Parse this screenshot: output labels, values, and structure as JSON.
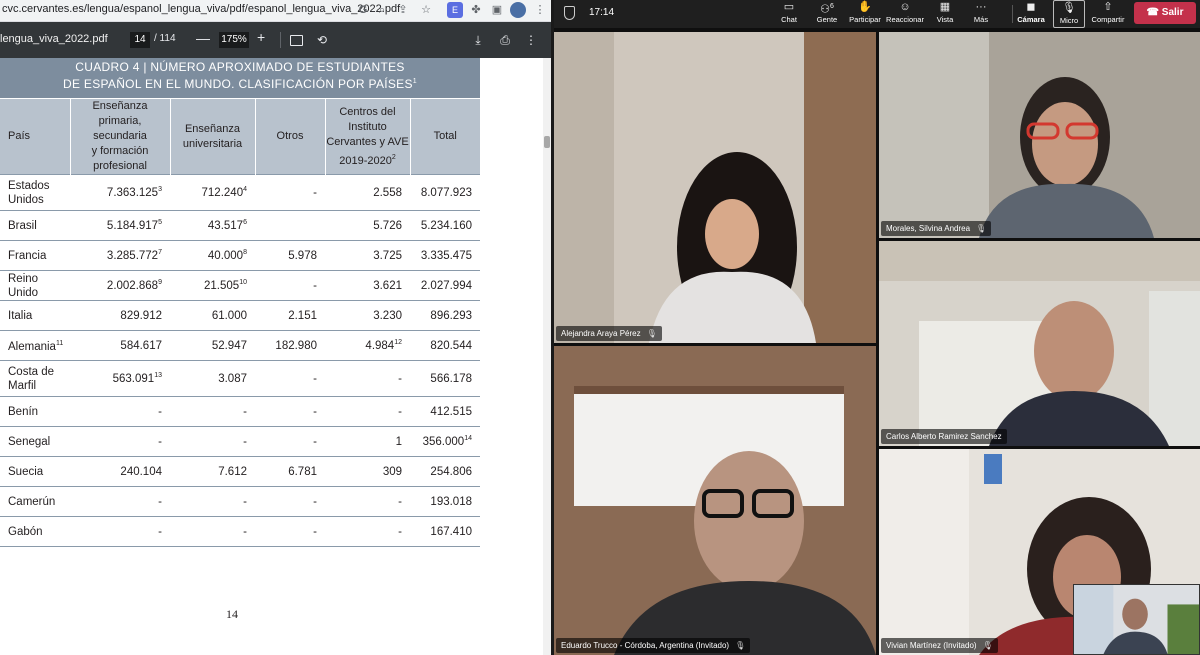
{
  "browser": {
    "url": "cvc.cervantes.es/lengua/espanol_lengua_viva/pdf/espanol_lengua_viva_2022.pdf",
    "icons": [
      "google-icon",
      "zoom-icon",
      "share-icon",
      "star-icon",
      "extension-icon",
      "puzzle-icon",
      "sidebar-icon",
      "avatar-icon"
    ]
  },
  "pdf_toolbar": {
    "filename": "lengua_viva_2022.pdf",
    "page_current": "14",
    "page_total": "/ 114",
    "zoom_minus": "—",
    "zoom": "175%",
    "zoom_plus": "+",
    "icons": [
      "fit-page-icon",
      "rotate-icon",
      "download-icon",
      "print-icon",
      "more-icon"
    ]
  },
  "document": {
    "title_line1": "CUADRO 4  |  NÚMERO APROXIMADO DE ESTUDIANTES",
    "title_line2": "DE ESPAÑOL EN EL MUNDO. CLASIFICACIÓN POR PAÍSES",
    "title_sup": "1",
    "headers": {
      "country": "País",
      "primaria": [
        "Enseñanza primaria,",
        "secundaria",
        "y formación",
        "profesional"
      ],
      "universitaria": [
        "Enseñanza",
        "universitaria"
      ],
      "otros": "Otros",
      "centros": [
        "Centros del",
        "Instituto",
        "Cervantes y AVE",
        "2019-2020"
      ],
      "centros_sup": "2",
      "total": "Total"
    },
    "rows": [
      {
        "country": [
          "Estados",
          "Unidos"
        ],
        "country_sup": "",
        "primaria": "7.363.125",
        "primaria_sup": "3",
        "universitaria": "712.240",
        "universitaria_sup": "4",
        "otros": "-",
        "centros": "2.558",
        "centros_sup": "",
        "total": "8.077.923",
        "total_sup": ""
      },
      {
        "country": [
          "Brasil"
        ],
        "country_sup": "",
        "primaria": "5.184.917",
        "primaria_sup": "5",
        "universitaria": "43.517",
        "universitaria_sup": "6",
        "otros": "",
        "centros": "5.726",
        "centros_sup": "",
        "total": "5.234.160",
        "total_sup": ""
      },
      {
        "country": [
          "Francia"
        ],
        "country_sup": "",
        "primaria": "3.285.772",
        "primaria_sup": "7",
        "universitaria": "40.000",
        "universitaria_sup": "8",
        "otros": "5.978",
        "centros": "3.725",
        "centros_sup": "",
        "total": "3.335.475",
        "total_sup": ""
      },
      {
        "country": [
          "Reino Unido"
        ],
        "country_sup": "",
        "primaria": "2.002.868",
        "primaria_sup": "9",
        "universitaria": "21.505",
        "universitaria_sup": "10",
        "otros": "-",
        "centros": "3.621",
        "centros_sup": "",
        "total": "2.027.994",
        "total_sup": ""
      },
      {
        "country": [
          "Italia"
        ],
        "country_sup": "",
        "primaria": "829.912",
        "primaria_sup": "",
        "universitaria": "61.000",
        "universitaria_sup": "",
        "otros": "2.151",
        "centros": "3.230",
        "centros_sup": "",
        "total": "896.293",
        "total_sup": ""
      },
      {
        "country": [
          "Alemania"
        ],
        "country_sup": "11",
        "primaria": "584.617",
        "primaria_sup": "",
        "universitaria": "52.947",
        "universitaria_sup": "",
        "otros": "182.980",
        "centros": "4.984",
        "centros_sup": "12",
        "total": "820.544",
        "total_sup": ""
      },
      {
        "country": [
          "Costa de",
          "Marfil"
        ],
        "country_sup": "",
        "primaria": "563.091",
        "primaria_sup": "13",
        "universitaria": "3.087",
        "universitaria_sup": "",
        "otros": "-",
        "centros": "-",
        "centros_sup": "",
        "total": "566.178",
        "total_sup": ""
      },
      {
        "country": [
          "Benín"
        ],
        "country_sup": "",
        "primaria": "-",
        "primaria_sup": "",
        "universitaria": "-",
        "universitaria_sup": "",
        "otros": "-",
        "centros": "-",
        "centros_sup": "",
        "total": "412.515",
        "total_sup": ""
      },
      {
        "country": [
          "Senegal"
        ],
        "country_sup": "",
        "primaria": "-",
        "primaria_sup": "",
        "universitaria": "-",
        "universitaria_sup": "",
        "otros": "-",
        "centros": "1",
        "centros_sup": "",
        "total": "356.000",
        "total_sup": "14"
      },
      {
        "country": [
          "Suecia"
        ],
        "country_sup": "",
        "primaria": "240.104",
        "primaria_sup": "",
        "universitaria": "7.612",
        "universitaria_sup": "",
        "otros": "6.781",
        "centros": "309",
        "centros_sup": "",
        "total": "254.806",
        "total_sup": ""
      },
      {
        "country": [
          "Camerún"
        ],
        "country_sup": "",
        "primaria": "-",
        "primaria_sup": "",
        "universitaria": "-",
        "universitaria_sup": "",
        "otros": "-",
        "centros": "-",
        "centros_sup": "",
        "total": "193.018",
        "total_sup": ""
      },
      {
        "country": [
          "Gabón"
        ],
        "country_sup": "",
        "primaria": "-",
        "primaria_sup": "",
        "universitaria": "-",
        "universitaria_sup": "",
        "otros": "-",
        "centros": "-",
        "centros_sup": "",
        "total": "167.410",
        "total_sup": ""
      }
    ],
    "page_number": "14"
  },
  "meeting": {
    "time": "17:14",
    "toolbar": {
      "chat": "Chat",
      "people": "Gente",
      "people_count": "6",
      "participate": "Participar",
      "react": "Reaccionar",
      "view": "Vista",
      "more": "Más",
      "camera": "Cámara",
      "mic": "Micro",
      "share": "Compartir",
      "leave": "Salir"
    },
    "participants": [
      {
        "name": "Alejandra Araya Pérez",
        "muted": true
      },
      {
        "name": "Morales, Silvina Andrea",
        "muted": true
      },
      {
        "name": "Carlos Alberto Ramirez Sanchez",
        "muted": false,
        "speaking": true
      },
      {
        "name": "Eduardo Trucco - Córdoba, Argentina (Invitado)",
        "muted": true
      },
      {
        "name": "Vivian Martínez (Invitado)",
        "muted": true
      }
    ],
    "colors": {
      "accent": "#6264a7",
      "leave": "#c4314b",
      "toolbar": "#1f1f1f"
    }
  }
}
